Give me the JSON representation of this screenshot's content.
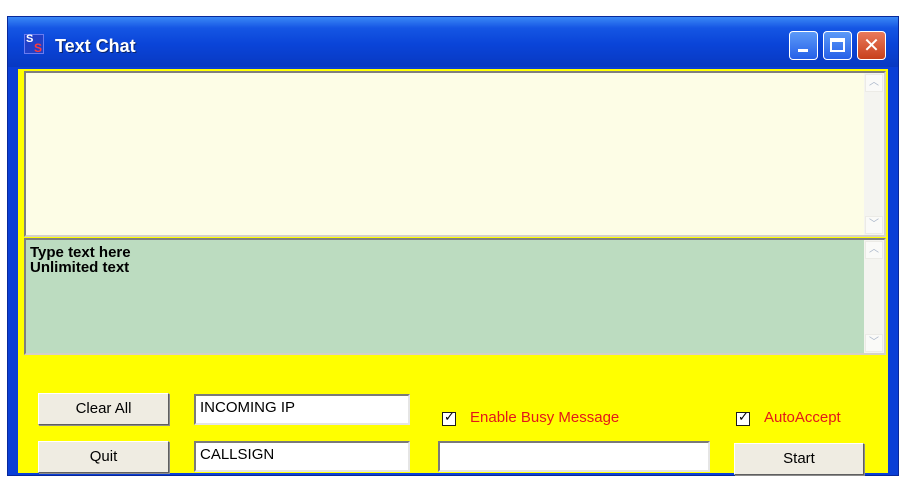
{
  "window": {
    "title": "Text Chat",
    "icon_text_top": "S",
    "icon_text_bottom": "S"
  },
  "caption_buttons": {
    "close_glyph": "✕"
  },
  "output_pane": {
    "text": ""
  },
  "input_pane": {
    "text": "Type text here\nUnlimited text"
  },
  "scrollbar": {
    "up_glyph": "︿",
    "down_glyph": "﹀"
  },
  "controls": {
    "clear_all_label": "Clear All",
    "quit_label": "Quit",
    "incoming_ip_value": "INCOMING IP",
    "callsign_value": "CALLSIGN",
    "busy_message_value": "",
    "enable_busy_label": "Enable Busy Message",
    "enable_busy_checked": true,
    "auto_accept_label": "AutoAccept",
    "auto_accept_checked": true,
    "start_label": "Start",
    "check_glyph": "✓"
  },
  "colors": {
    "titlebar": "#0a44d8",
    "client_background": "#ffff00",
    "output_background": "#fdfde6",
    "input_background": "#bcdcc0",
    "checkbox_label": "#e31919"
  }
}
